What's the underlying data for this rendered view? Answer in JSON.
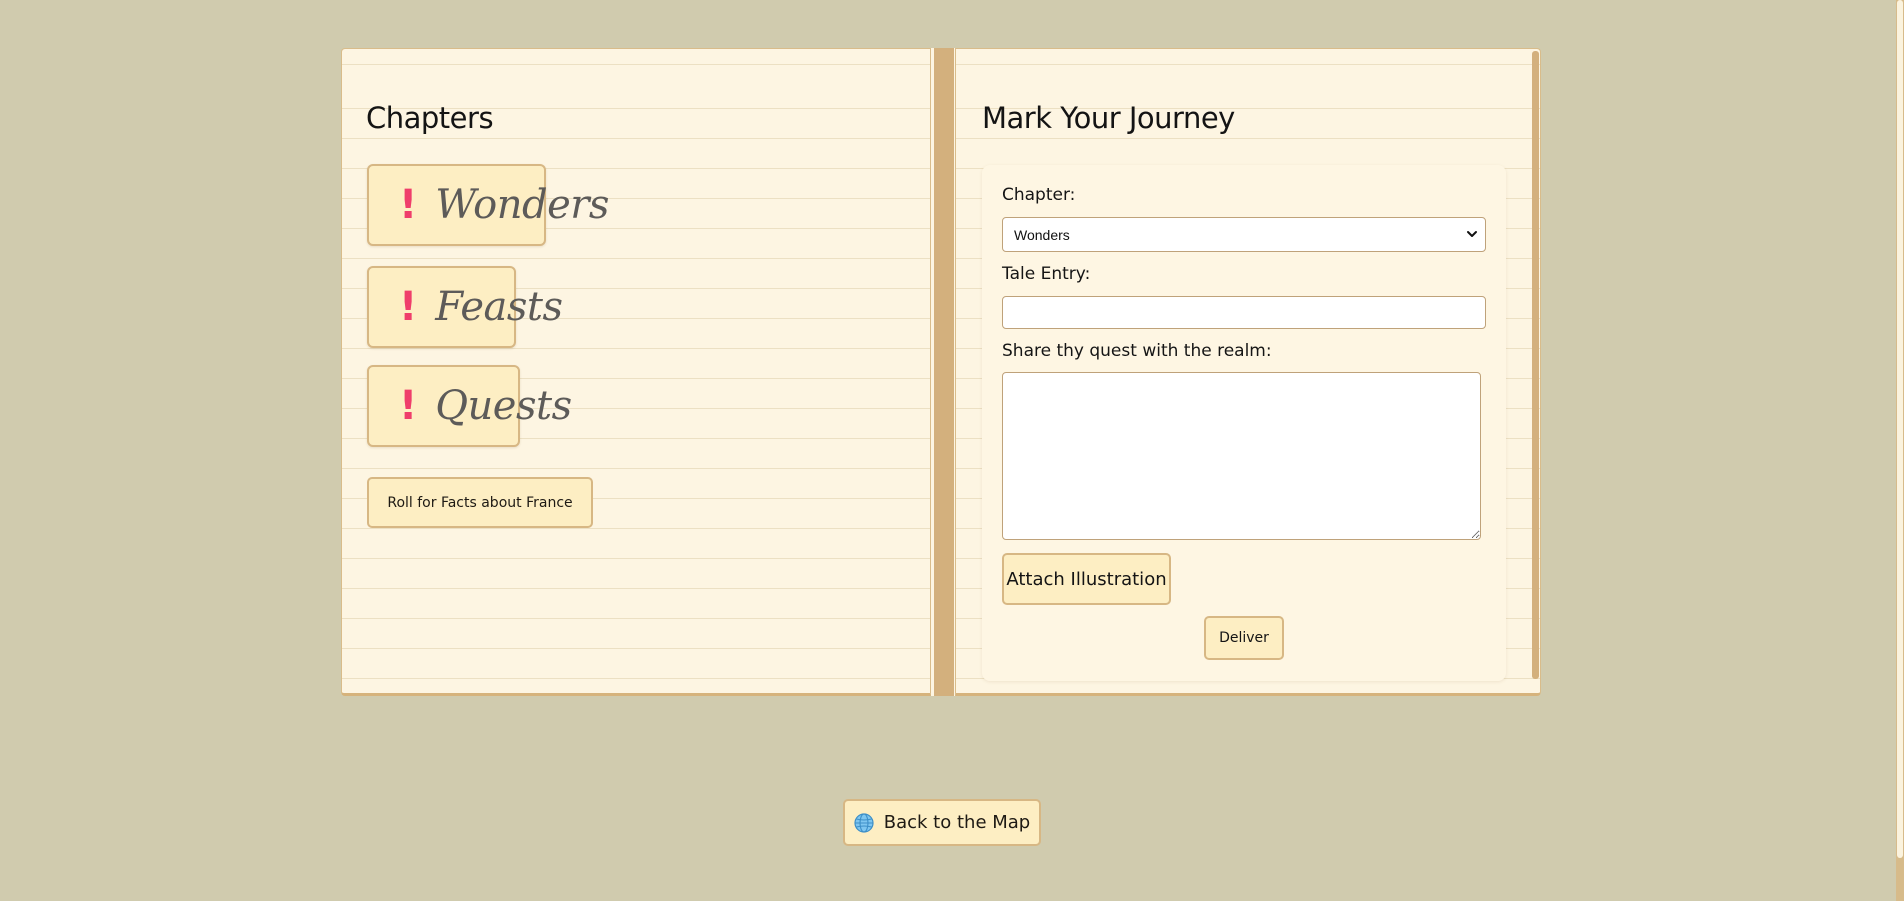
{
  "left_page": {
    "title": "Chapters",
    "chapters": [
      {
        "icon": "exclamation-icon",
        "label": "Wonders"
      },
      {
        "icon": "exclamation-icon",
        "label": "Feasts"
      },
      {
        "icon": "exclamation-icon",
        "label": "Quests"
      }
    ],
    "chapter_icon_glyph": "!",
    "roll_button": "Roll for Facts about France"
  },
  "right_page": {
    "title": "Mark Your Journey",
    "form": {
      "chapter_label": "Chapter:",
      "chapter_selected": "Wonders",
      "tale_entry_label": "Tale Entry:",
      "tale_entry_value": "",
      "quest_label": "Share thy quest with the realm:",
      "quest_value": "",
      "attach_button": "Attach Illustration",
      "deliver_button": "Deliver"
    }
  },
  "back_button": {
    "icon": "globe-icon",
    "label": "Back to the Map"
  },
  "colors": {
    "background": "#d0cbae",
    "page": "#fdf5e2",
    "button": "#fdeec3",
    "button_border": "#d7b784",
    "spine": "#d3b07d",
    "accent": "#ef3e6b"
  }
}
